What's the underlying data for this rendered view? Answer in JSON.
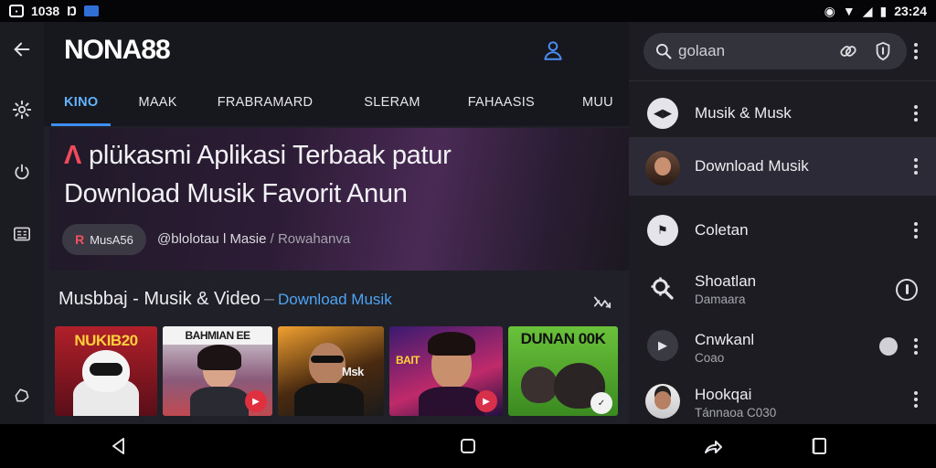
{
  "status": {
    "time_left": "1038",
    "time_right": "23:24"
  },
  "rail": {
    "items": [
      {
        "name": "back-icon",
        "glyph": "←"
      },
      {
        "name": "gear-icon",
        "glyph": "⚙"
      },
      {
        "name": "power-icon",
        "glyph": "⏻"
      },
      {
        "name": "contact-card-icon",
        "glyph": "▤"
      },
      {
        "name": "bookmark-icon",
        "glyph": "⬡"
      }
    ]
  },
  "app": {
    "title": "NONA88"
  },
  "tabs": [
    "KINO",
    "MAAK",
    "FRABRAMARD",
    "SLERAM",
    "FAHAASIS",
    "MUU"
  ],
  "hero": {
    "mark": "Λ",
    "line1": "plükasmi Aplikasi Terbaak patur",
    "line2": "Download Musik Favorit Anun",
    "chip_icon": "R",
    "chip_label": "MusA56",
    "meta_main": "@blolotau l Masie",
    "meta_sep": "/",
    "meta_sub": "Rowahanva"
  },
  "section": {
    "title": "Musbbaj - Musik & Video",
    "dash": "–",
    "link": "Download Musik"
  },
  "thumbnails": [
    {
      "text": "NUKIB20",
      "text_color": "#ffcf3a"
    },
    {
      "text": "BAHMIAN EE",
      "text_color": "#1a1a1a"
    },
    {
      "text": "Msk",
      "text_color": "#f1f1f1"
    },
    {
      "text": "BAIT",
      "text_color": "#ffd23a"
    },
    {
      "text": "DUNAN 00K",
      "text_color": "#111111"
    }
  ],
  "panel": {
    "search_placeholder": "golaan",
    "items": [
      {
        "label": "Musik & Musk",
        "sub": "",
        "icon": "▶◀",
        "selected": false
      },
      {
        "label": "Download Musik",
        "sub": "",
        "icon": "avatar",
        "selected": true
      },
      {
        "label": "Coletan",
        "sub": "",
        "icon": "⚑",
        "selected": false
      },
      {
        "label": "Shoatlan",
        "sub": "Damaara",
        "icon": "🔍",
        "selected": false
      },
      {
        "label": "Cnwkanl",
        "sub": "Coao",
        "icon": "▶",
        "selected": false
      },
      {
        "label": "Hookqai",
        "sub": "Tánnaoa C030",
        "icon": "avatar",
        "selected": false
      }
    ]
  },
  "colors": {
    "accent": "#3e8ff0",
    "link": "#4ea3f2",
    "brand_red": "#ef4b5a",
    "panel_bg": "#1c1c22",
    "main_bg": "#202128"
  }
}
